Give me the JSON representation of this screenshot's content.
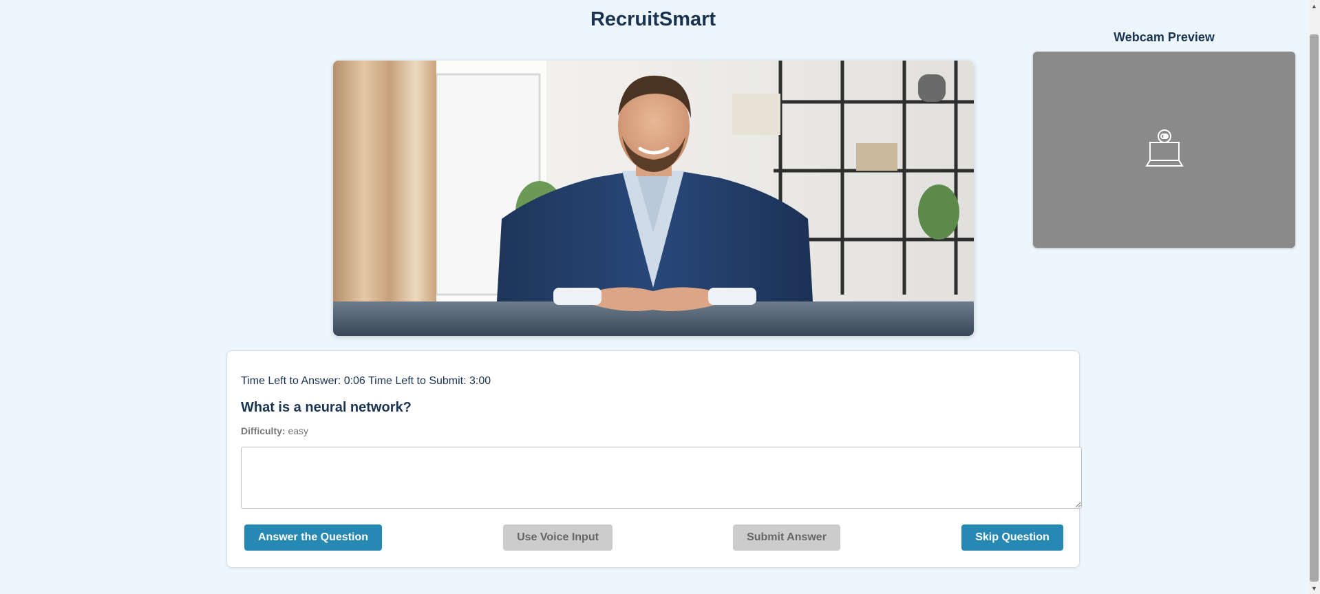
{
  "app": {
    "title": "RecruitSmart"
  },
  "interviewer": {
    "image_alt": "Interviewer avatar"
  },
  "webcam": {
    "title": "Webcam Preview",
    "icon": "webcam-laptop-icon"
  },
  "question_card": {
    "timer_text": "Time Left to Answer: 0:06 Time Left to Submit: 3:00",
    "question": "What is a neural network?",
    "difficulty_label": "Difficulty:",
    "difficulty_value": "easy",
    "answer_value": "",
    "buttons": {
      "answer": "Answer the Question",
      "voice": "Use Voice Input",
      "submit": "Submit Answer",
      "skip": "Skip Question"
    }
  },
  "colors": {
    "background": "#eef6fd",
    "primary_button": "#2589b4",
    "disabled_button": "#cccccc",
    "heading": "#1a3350",
    "webcam_placeholder": "#8a8a8a"
  }
}
